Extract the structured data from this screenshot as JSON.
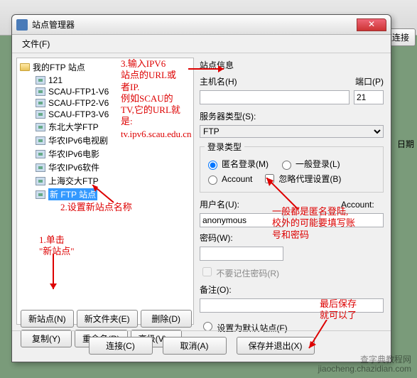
{
  "bg": {
    "quick_connect": "速连接",
    "date_label": "日期"
  },
  "dialog": {
    "title": "站点管理器",
    "menu": {
      "file": "文件(F)"
    },
    "tree": {
      "root": "我的FTP 站点",
      "items": [
        "121",
        "SCAU-FTP1-V6",
        "SCAU-FTP2-V6",
        "SCAU-FTP3-V6",
        "东北大学FTP",
        "华农IPv6电视剧",
        "华农IPv6电影",
        "华农IPv6软件",
        "上海交大FTP",
        "新 FTP 站点"
      ],
      "selected_index": 9
    },
    "buttons_left": {
      "new_site": "新站点(N)",
      "new_folder": "新文件夹(E)",
      "delete": "删除(D)",
      "copy": "复制(Y)",
      "rename": "重命名(R)",
      "advanced": "高级(V)..."
    },
    "right": {
      "section_title": "站点信息",
      "host_label": "主机名(H)",
      "host_value": "",
      "port_label": "端口(P)",
      "port_value": "21",
      "server_type_label": "服务器类型(S):",
      "server_type_value": "FTP",
      "logon_group": "登录类型",
      "anonymous": "匿名登录(M)",
      "normal": "一般登录(L)",
      "account": "Account",
      "ignore_proxy": "忽略代理设置(B)",
      "user_label": "用户名(U):",
      "user_value": "anonymous",
      "account_label": "Account:",
      "account_value": "",
      "pass_label": "密码(W):",
      "pass_value": "",
      "no_remember": "不要记住密码(R)",
      "memo_label": "备注(O):",
      "memo_value": "",
      "set_default": "设置为默认站点(F)"
    },
    "buttons_bottom": {
      "connect": "连接(C)",
      "cancel": "取消(A)",
      "save_exit": "保存并退出(X)"
    }
  },
  "annotations": {
    "a1": "1.单击\n\"新站点\"",
    "a2": "2.设置新站点名称",
    "a3": "3.输入IPV6\n站点的URL或\n者IP.\n例如SCAU的\nTV,它的URL就\n是:",
    "a3_url": "tv.ipv6.scau.edu.cn",
    "a4": "一般都是匿名登陆,\n校外的可能要填写账\n号和密码",
    "a5": "最后保存\n就可以了"
  },
  "watermark": {
    "line1": "查字典教程网",
    "line2": "jiaocheng.chazidian.com"
  }
}
